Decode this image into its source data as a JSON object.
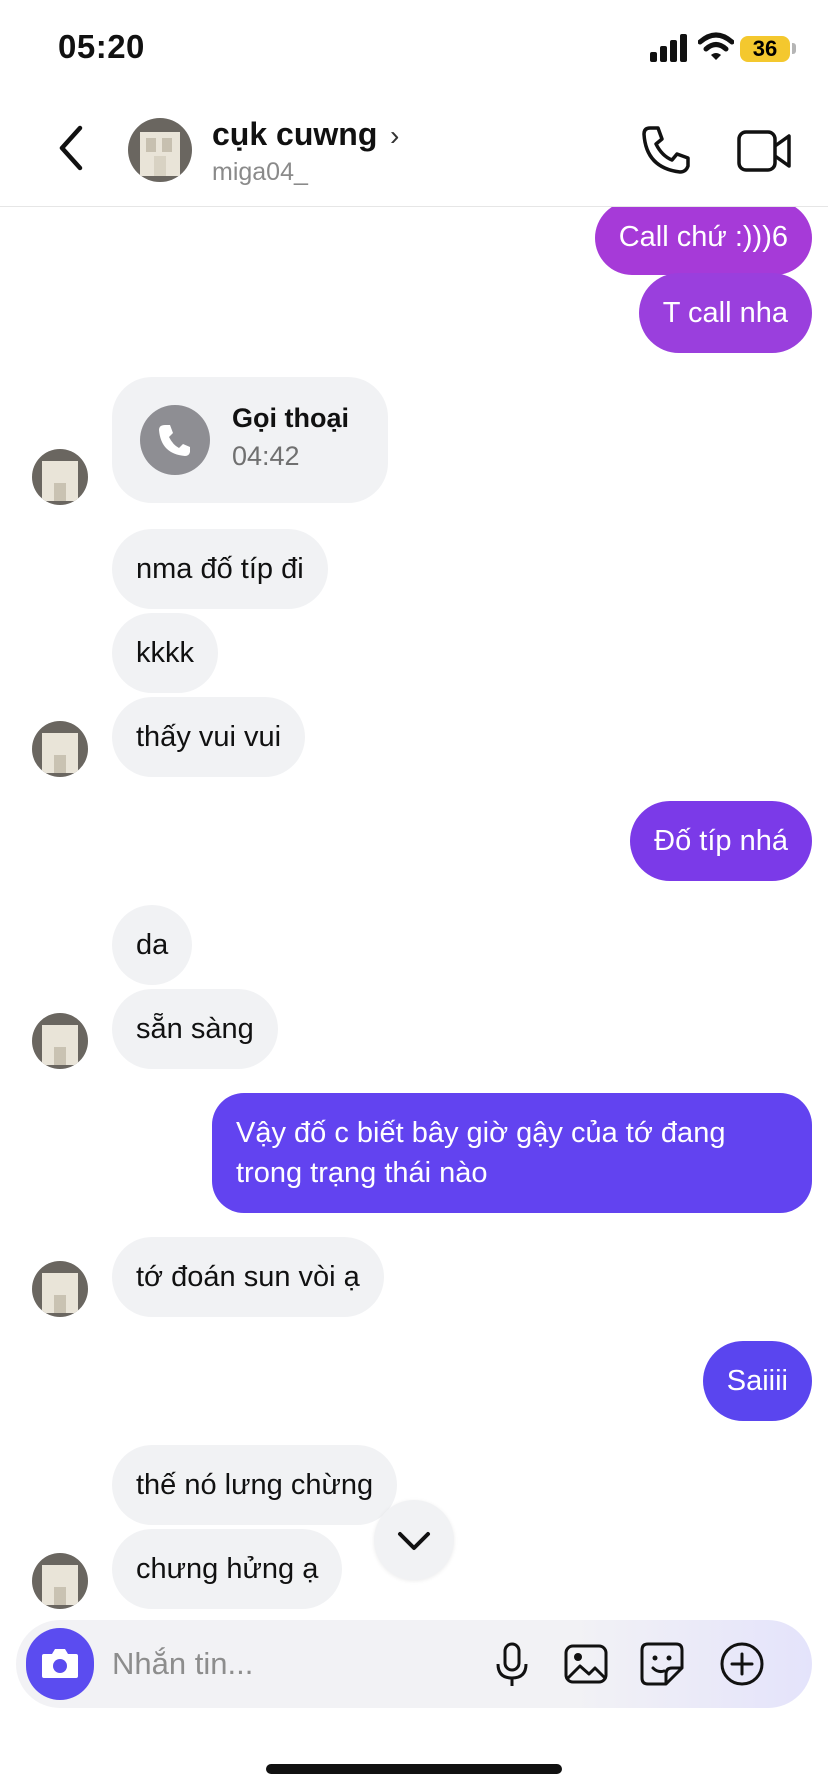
{
  "status_bar": {
    "time": "05:20",
    "battery": "36"
  },
  "header": {
    "contact_name": "cụk cuwng",
    "username": "miga04_",
    "chevron": "›",
    "icons": [
      "back-icon",
      "avatar",
      "phone-icon",
      "video-camera-icon"
    ]
  },
  "messages": {
    "m1": "Call chứ :)))6",
    "m2": "T call nha",
    "call": {
      "title": "Gọi thoại",
      "duration": "04:42"
    },
    "m3": "nma đố típ đi",
    "m4": "kkkk",
    "m5": "thấy vui vui",
    "m6": "Đố típ nhá",
    "m7": "da",
    "m8": "sẵn sàng",
    "m9_line1": "Vậy đố c biết bây giờ gậy của tớ đang",
    "m9_line2": "trong trạng thái nào",
    "m10": "tớ đoán sun vòi ạ",
    "m11": "Saiiii",
    "m12": "thế nó lưng chừng",
    "m13": "chưng hửng ạ"
  },
  "composer": {
    "placeholder": "Nhắn tin...",
    "icons": [
      "camera-icon",
      "microphone-icon",
      "image-icon",
      "sticker-icon",
      "plus-icon"
    ]
  },
  "colors": {
    "out_purple_1": "#a63ad8",
    "out_purple_2": "#9a3fdd",
    "out_violet_1": "#7b3ae8",
    "out_violet_2": "#6243f0",
    "out_violet_3": "#5a45ef",
    "incoming_bg": "#f1f2f4",
    "camera_button": "#5b4cf0"
  }
}
